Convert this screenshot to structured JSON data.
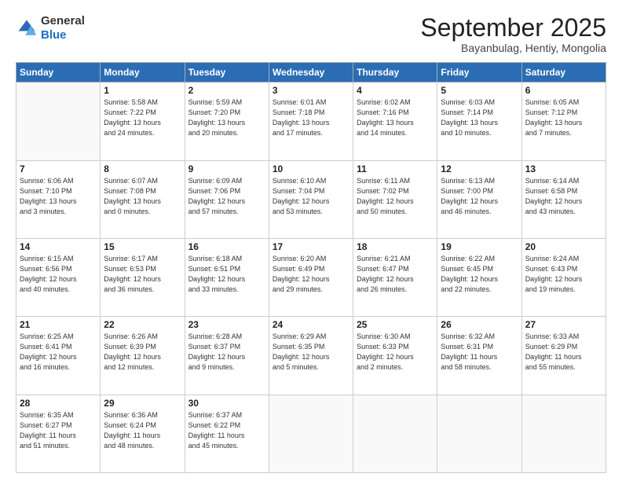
{
  "header": {
    "logo_general": "General",
    "logo_blue": "Blue",
    "month_title": "September 2025",
    "subtitle": "Bayanbulag, Hentiy, Mongolia"
  },
  "weekdays": [
    "Sunday",
    "Monday",
    "Tuesday",
    "Wednesday",
    "Thursday",
    "Friday",
    "Saturday"
  ],
  "weeks": [
    [
      {
        "day": "",
        "info": ""
      },
      {
        "day": "1",
        "info": "Sunrise: 5:58 AM\nSunset: 7:22 PM\nDaylight: 13 hours\nand 24 minutes."
      },
      {
        "day": "2",
        "info": "Sunrise: 5:59 AM\nSunset: 7:20 PM\nDaylight: 13 hours\nand 20 minutes."
      },
      {
        "day": "3",
        "info": "Sunrise: 6:01 AM\nSunset: 7:18 PM\nDaylight: 13 hours\nand 17 minutes."
      },
      {
        "day": "4",
        "info": "Sunrise: 6:02 AM\nSunset: 7:16 PM\nDaylight: 13 hours\nand 14 minutes."
      },
      {
        "day": "5",
        "info": "Sunrise: 6:03 AM\nSunset: 7:14 PM\nDaylight: 13 hours\nand 10 minutes."
      },
      {
        "day": "6",
        "info": "Sunrise: 6:05 AM\nSunset: 7:12 PM\nDaylight: 13 hours\nand 7 minutes."
      }
    ],
    [
      {
        "day": "7",
        "info": "Sunrise: 6:06 AM\nSunset: 7:10 PM\nDaylight: 13 hours\nand 3 minutes."
      },
      {
        "day": "8",
        "info": "Sunrise: 6:07 AM\nSunset: 7:08 PM\nDaylight: 13 hours\nand 0 minutes."
      },
      {
        "day": "9",
        "info": "Sunrise: 6:09 AM\nSunset: 7:06 PM\nDaylight: 12 hours\nand 57 minutes."
      },
      {
        "day": "10",
        "info": "Sunrise: 6:10 AM\nSunset: 7:04 PM\nDaylight: 12 hours\nand 53 minutes."
      },
      {
        "day": "11",
        "info": "Sunrise: 6:11 AM\nSunset: 7:02 PM\nDaylight: 12 hours\nand 50 minutes."
      },
      {
        "day": "12",
        "info": "Sunrise: 6:13 AM\nSunset: 7:00 PM\nDaylight: 12 hours\nand 46 minutes."
      },
      {
        "day": "13",
        "info": "Sunrise: 6:14 AM\nSunset: 6:58 PM\nDaylight: 12 hours\nand 43 minutes."
      }
    ],
    [
      {
        "day": "14",
        "info": "Sunrise: 6:15 AM\nSunset: 6:56 PM\nDaylight: 12 hours\nand 40 minutes."
      },
      {
        "day": "15",
        "info": "Sunrise: 6:17 AM\nSunset: 6:53 PM\nDaylight: 12 hours\nand 36 minutes."
      },
      {
        "day": "16",
        "info": "Sunrise: 6:18 AM\nSunset: 6:51 PM\nDaylight: 12 hours\nand 33 minutes."
      },
      {
        "day": "17",
        "info": "Sunrise: 6:20 AM\nSunset: 6:49 PM\nDaylight: 12 hours\nand 29 minutes."
      },
      {
        "day": "18",
        "info": "Sunrise: 6:21 AM\nSunset: 6:47 PM\nDaylight: 12 hours\nand 26 minutes."
      },
      {
        "day": "19",
        "info": "Sunrise: 6:22 AM\nSunset: 6:45 PM\nDaylight: 12 hours\nand 22 minutes."
      },
      {
        "day": "20",
        "info": "Sunrise: 6:24 AM\nSunset: 6:43 PM\nDaylight: 12 hours\nand 19 minutes."
      }
    ],
    [
      {
        "day": "21",
        "info": "Sunrise: 6:25 AM\nSunset: 6:41 PM\nDaylight: 12 hours\nand 16 minutes."
      },
      {
        "day": "22",
        "info": "Sunrise: 6:26 AM\nSunset: 6:39 PM\nDaylight: 12 hours\nand 12 minutes."
      },
      {
        "day": "23",
        "info": "Sunrise: 6:28 AM\nSunset: 6:37 PM\nDaylight: 12 hours\nand 9 minutes."
      },
      {
        "day": "24",
        "info": "Sunrise: 6:29 AM\nSunset: 6:35 PM\nDaylight: 12 hours\nand 5 minutes."
      },
      {
        "day": "25",
        "info": "Sunrise: 6:30 AM\nSunset: 6:33 PM\nDaylight: 12 hours\nand 2 minutes."
      },
      {
        "day": "26",
        "info": "Sunrise: 6:32 AM\nSunset: 6:31 PM\nDaylight: 11 hours\nand 58 minutes."
      },
      {
        "day": "27",
        "info": "Sunrise: 6:33 AM\nSunset: 6:29 PM\nDaylight: 11 hours\nand 55 minutes."
      }
    ],
    [
      {
        "day": "28",
        "info": "Sunrise: 6:35 AM\nSunset: 6:27 PM\nDaylight: 11 hours\nand 51 minutes."
      },
      {
        "day": "29",
        "info": "Sunrise: 6:36 AM\nSunset: 6:24 PM\nDaylight: 11 hours\nand 48 minutes."
      },
      {
        "day": "30",
        "info": "Sunrise: 6:37 AM\nSunset: 6:22 PM\nDaylight: 11 hours\nand 45 minutes."
      },
      {
        "day": "",
        "info": ""
      },
      {
        "day": "",
        "info": ""
      },
      {
        "day": "",
        "info": ""
      },
      {
        "day": "",
        "info": ""
      }
    ]
  ]
}
